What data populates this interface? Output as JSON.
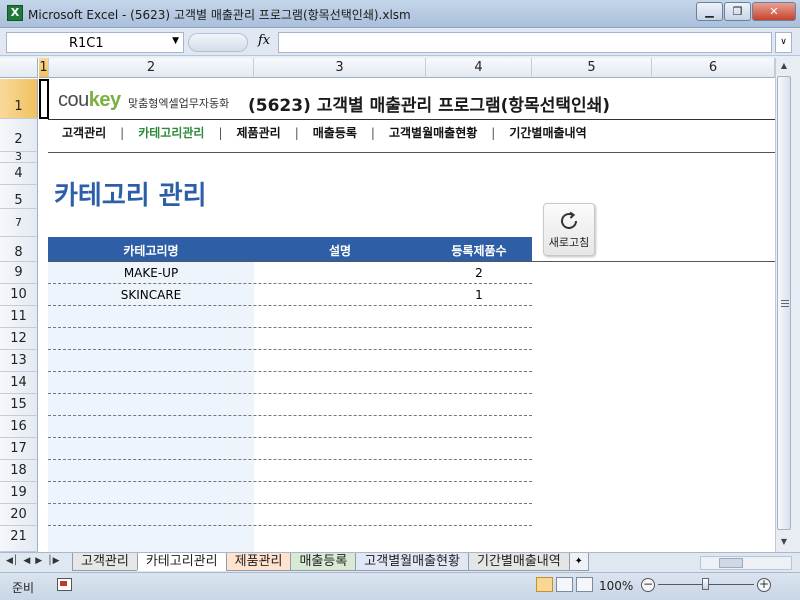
{
  "window": {
    "title": "Microsoft Excel - (5623) 고객별 매출관리 프로그램(항목선택인쇄).xlsm",
    "app_icon_glyph": "X",
    "controls": [
      "minimize-icon",
      "restore-icon",
      "close-icon"
    ]
  },
  "formula_bar": {
    "name_box": "R1C1",
    "fx_label": "fx",
    "formula": ""
  },
  "columns": [
    "1",
    "2",
    "3",
    "4",
    "5",
    "6"
  ],
  "rows": [
    "1",
    "2",
    "3",
    "4",
    "5",
    "7",
    "8",
    "9",
    "10",
    "11",
    "12",
    "13",
    "14",
    "15",
    "16",
    "17",
    "18",
    "19",
    "20",
    "21"
  ],
  "sheet": {
    "logo_text_a": "cou",
    "logo_text_b": "key",
    "logo_tagline": "맞춤형엑셀업무자동화",
    "title": "(5623) 고객별 매출관리 프로그램(항목선택인쇄)",
    "nav": [
      {
        "label": "고객관리",
        "active": false
      },
      {
        "label": "카테고리관리",
        "active": true
      },
      {
        "label": "제품관리",
        "active": false
      },
      {
        "label": "매출등록",
        "active": false
      },
      {
        "label": "고객별월매출현황",
        "active": false
      },
      {
        "label": "기간별매출내역",
        "active": false
      }
    ],
    "nav_separator": "|",
    "heading": "카테고리 관리",
    "refresh_button": "새로고침",
    "table": {
      "headers": [
        "카테고리명",
        "설명",
        "등록제품수"
      ],
      "rows": [
        {
          "category": "MAKE-UP",
          "description": "",
          "count": "2"
        },
        {
          "category": "SKINCARE",
          "description": "",
          "count": "1"
        }
      ]
    },
    "colors": {
      "accent_green": "#2f8a3e",
      "heading_blue": "#2d5fa8",
      "table_header_bg": "#2e5ea6"
    }
  },
  "tabs": [
    "고객관리",
    "카테고리관리",
    "제품관리",
    "매출등록",
    "고객별월매출현황",
    "기간별매출내역"
  ],
  "active_tab": "카테고리관리",
  "status": {
    "ready": "준비",
    "zoom": "100%"
  }
}
